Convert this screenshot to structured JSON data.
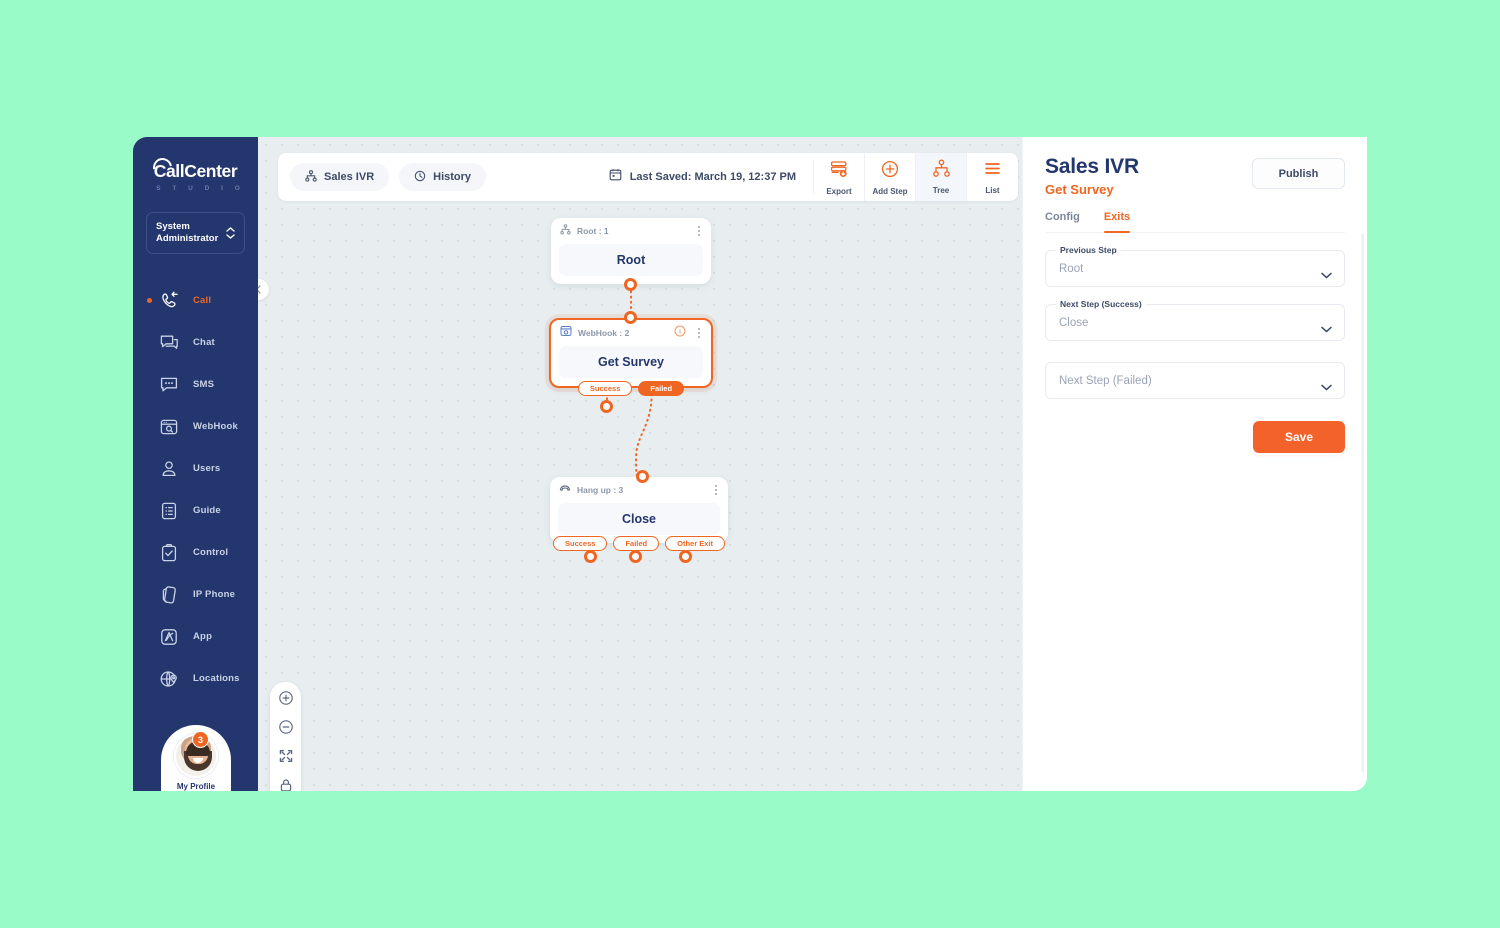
{
  "brand": {
    "logo_main": "CallCenter",
    "logo_sub": "S T U D I O",
    "accent": "#ef6623",
    "navy": "#23366d",
    "page_background": "#99fbc8"
  },
  "sidebar": {
    "role": "System\nAdministrator",
    "role_line1": "System",
    "role_line2": "Administrator",
    "items": [
      {
        "label": "Call",
        "icon": "incoming-call-icon",
        "active": true
      },
      {
        "label": "Chat",
        "icon": "chat-bubble-icon",
        "active": false
      },
      {
        "label": "SMS",
        "icon": "sms-bubble-icon",
        "active": false
      },
      {
        "label": "WebHook",
        "icon": "webhook-window-icon",
        "active": false
      },
      {
        "label": "Users",
        "icon": "user-icon",
        "active": false
      },
      {
        "label": "Guide",
        "icon": "guide-list-icon",
        "active": false
      },
      {
        "label": "Control",
        "icon": "clipboard-check-icon",
        "active": false
      },
      {
        "label": "IP Phone",
        "icon": "ip-phone-icon",
        "active": false
      },
      {
        "label": "App",
        "icon": "app-icon",
        "active": false
      },
      {
        "label": "Locations",
        "icon": "globe-pin-icon",
        "active": false
      }
    ],
    "profile": {
      "badge_count": "3",
      "name": "My Profile"
    }
  },
  "toolbar": {
    "chips": [
      {
        "label": "Sales IVR",
        "icon": "tree-nodes-icon"
      },
      {
        "label": "History",
        "icon": "clock-history-icon"
      }
    ],
    "saved_prefix": "Last Saved: ",
    "saved_value": "March 19, 12:37 PM",
    "saved_icon": "calendar-icon",
    "buttons": [
      {
        "label": "Export",
        "icon": "export-database-icon",
        "active": false
      },
      {
        "label": "Add Step",
        "icon": "plus-circle-icon",
        "active": false
      },
      {
        "label": "Tree",
        "icon": "tree-view-icon",
        "active": true
      },
      {
        "label": "List",
        "icon": "list-view-icon",
        "active": false
      }
    ]
  },
  "canvas": {
    "nodes": [
      {
        "type_label": "Root : 1",
        "type_icon": "tree-nodes-icon",
        "title": "Root",
        "selected": false,
        "exits": []
      },
      {
        "type_label": "WebHook : 2",
        "type_icon": "webhook-window-icon",
        "title": "Get Survey",
        "selected": true,
        "has_info": true,
        "exits": [
          {
            "label": "Success",
            "filled": false
          },
          {
            "label": "Failed",
            "filled": true
          }
        ]
      },
      {
        "type_label": "Hang up : 3",
        "type_icon": "hangup-phone-icon",
        "title": "Close",
        "selected": false,
        "exits": [
          {
            "label": "Success",
            "filled": false
          },
          {
            "label": "Failed",
            "filled": false
          },
          {
            "label": "Other Exit",
            "filled": false
          }
        ]
      }
    ],
    "zoom_controls": [
      {
        "icon": "zoom-in-icon"
      },
      {
        "icon": "zoom-out-icon"
      },
      {
        "icon": "fit-screen-icon"
      },
      {
        "icon": "lock-icon"
      }
    ],
    "collapse_icon": "chevron-left-icon"
  },
  "panel": {
    "title": "Sales IVR",
    "subtitle": "Get Survey",
    "publish_label": "Publish",
    "tabs": [
      {
        "label": "Config",
        "active": false
      },
      {
        "label": "Exits",
        "active": true
      }
    ],
    "fields": [
      {
        "label": "Previous Step",
        "value": "Root",
        "is_placeholder": false
      },
      {
        "label": "Next Step (Success)",
        "value": "Close",
        "is_placeholder": false
      },
      {
        "label": "",
        "value": "Next Step  (Failed)",
        "is_placeholder": true
      }
    ],
    "save_label": "Save"
  }
}
